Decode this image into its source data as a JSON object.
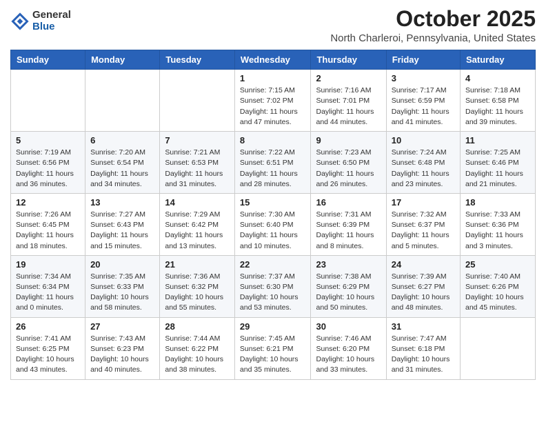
{
  "header": {
    "logo": {
      "general": "General",
      "blue": "Blue"
    },
    "title": "October 2025",
    "location": "North Charleroi, Pennsylvania, United States"
  },
  "days_of_week": [
    "Sunday",
    "Monday",
    "Tuesday",
    "Wednesday",
    "Thursday",
    "Friday",
    "Saturday"
  ],
  "weeks": [
    [
      {
        "day": "",
        "info": ""
      },
      {
        "day": "",
        "info": ""
      },
      {
        "day": "",
        "info": ""
      },
      {
        "day": "1",
        "info": "Sunrise: 7:15 AM\nSunset: 7:02 PM\nDaylight: 11 hours and 47 minutes."
      },
      {
        "day": "2",
        "info": "Sunrise: 7:16 AM\nSunset: 7:01 PM\nDaylight: 11 hours and 44 minutes."
      },
      {
        "day": "3",
        "info": "Sunrise: 7:17 AM\nSunset: 6:59 PM\nDaylight: 11 hours and 41 minutes."
      },
      {
        "day": "4",
        "info": "Sunrise: 7:18 AM\nSunset: 6:58 PM\nDaylight: 11 hours and 39 minutes."
      }
    ],
    [
      {
        "day": "5",
        "info": "Sunrise: 7:19 AM\nSunset: 6:56 PM\nDaylight: 11 hours and 36 minutes."
      },
      {
        "day": "6",
        "info": "Sunrise: 7:20 AM\nSunset: 6:54 PM\nDaylight: 11 hours and 34 minutes."
      },
      {
        "day": "7",
        "info": "Sunrise: 7:21 AM\nSunset: 6:53 PM\nDaylight: 11 hours and 31 minutes."
      },
      {
        "day": "8",
        "info": "Sunrise: 7:22 AM\nSunset: 6:51 PM\nDaylight: 11 hours and 28 minutes."
      },
      {
        "day": "9",
        "info": "Sunrise: 7:23 AM\nSunset: 6:50 PM\nDaylight: 11 hours and 26 minutes."
      },
      {
        "day": "10",
        "info": "Sunrise: 7:24 AM\nSunset: 6:48 PM\nDaylight: 11 hours and 23 minutes."
      },
      {
        "day": "11",
        "info": "Sunrise: 7:25 AM\nSunset: 6:46 PM\nDaylight: 11 hours and 21 minutes."
      }
    ],
    [
      {
        "day": "12",
        "info": "Sunrise: 7:26 AM\nSunset: 6:45 PM\nDaylight: 11 hours and 18 minutes."
      },
      {
        "day": "13",
        "info": "Sunrise: 7:27 AM\nSunset: 6:43 PM\nDaylight: 11 hours and 15 minutes."
      },
      {
        "day": "14",
        "info": "Sunrise: 7:29 AM\nSunset: 6:42 PM\nDaylight: 11 hours and 13 minutes."
      },
      {
        "day": "15",
        "info": "Sunrise: 7:30 AM\nSunset: 6:40 PM\nDaylight: 11 hours and 10 minutes."
      },
      {
        "day": "16",
        "info": "Sunrise: 7:31 AM\nSunset: 6:39 PM\nDaylight: 11 hours and 8 minutes."
      },
      {
        "day": "17",
        "info": "Sunrise: 7:32 AM\nSunset: 6:37 PM\nDaylight: 11 hours and 5 minutes."
      },
      {
        "day": "18",
        "info": "Sunrise: 7:33 AM\nSunset: 6:36 PM\nDaylight: 11 hours and 3 minutes."
      }
    ],
    [
      {
        "day": "19",
        "info": "Sunrise: 7:34 AM\nSunset: 6:34 PM\nDaylight: 11 hours and 0 minutes."
      },
      {
        "day": "20",
        "info": "Sunrise: 7:35 AM\nSunset: 6:33 PM\nDaylight: 10 hours and 58 minutes."
      },
      {
        "day": "21",
        "info": "Sunrise: 7:36 AM\nSunset: 6:32 PM\nDaylight: 10 hours and 55 minutes."
      },
      {
        "day": "22",
        "info": "Sunrise: 7:37 AM\nSunset: 6:30 PM\nDaylight: 10 hours and 53 minutes."
      },
      {
        "day": "23",
        "info": "Sunrise: 7:38 AM\nSunset: 6:29 PM\nDaylight: 10 hours and 50 minutes."
      },
      {
        "day": "24",
        "info": "Sunrise: 7:39 AM\nSunset: 6:27 PM\nDaylight: 10 hours and 48 minutes."
      },
      {
        "day": "25",
        "info": "Sunrise: 7:40 AM\nSunset: 6:26 PM\nDaylight: 10 hours and 45 minutes."
      }
    ],
    [
      {
        "day": "26",
        "info": "Sunrise: 7:41 AM\nSunset: 6:25 PM\nDaylight: 10 hours and 43 minutes."
      },
      {
        "day": "27",
        "info": "Sunrise: 7:43 AM\nSunset: 6:23 PM\nDaylight: 10 hours and 40 minutes."
      },
      {
        "day": "28",
        "info": "Sunrise: 7:44 AM\nSunset: 6:22 PM\nDaylight: 10 hours and 38 minutes."
      },
      {
        "day": "29",
        "info": "Sunrise: 7:45 AM\nSunset: 6:21 PM\nDaylight: 10 hours and 35 minutes."
      },
      {
        "day": "30",
        "info": "Sunrise: 7:46 AM\nSunset: 6:20 PM\nDaylight: 10 hours and 33 minutes."
      },
      {
        "day": "31",
        "info": "Sunrise: 7:47 AM\nSunset: 6:18 PM\nDaylight: 10 hours and 31 minutes."
      },
      {
        "day": "",
        "info": ""
      }
    ]
  ]
}
